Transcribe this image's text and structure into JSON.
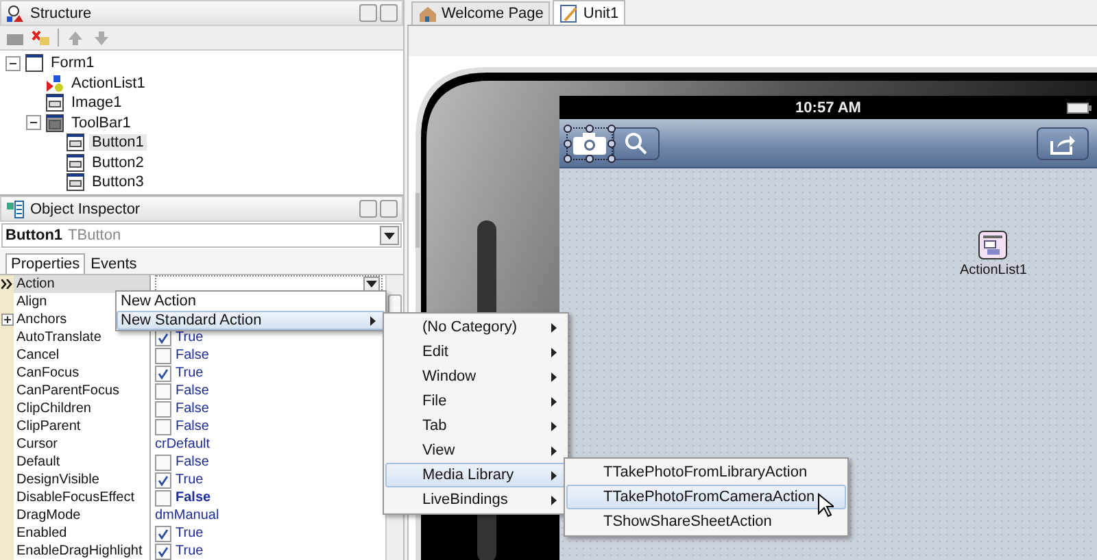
{
  "structure": {
    "title": "Structure",
    "tree": [
      {
        "label": "Form1",
        "kind": "form",
        "selected": false,
        "expanded": true,
        "children": [
          {
            "label": "ActionList1",
            "kind": "actionlist",
            "selected": false
          },
          {
            "label": "Image1",
            "kind": "control",
            "selected": false
          },
          {
            "label": "ToolBar1",
            "kind": "toolbar",
            "selected": false,
            "expanded": true,
            "children": [
              {
                "label": "Button1",
                "kind": "control",
                "selected": true
              },
              {
                "label": "Button2",
                "kind": "control",
                "selected": false
              },
              {
                "label": "Button3",
                "kind": "control",
                "selected": false
              }
            ]
          }
        ]
      }
    ]
  },
  "inspector": {
    "title": "Object Inspector",
    "object_name": "Button1",
    "object_type": "TButton",
    "tabs": [
      {
        "label": "Properties",
        "selected": true
      },
      {
        "label": "Events",
        "selected": false
      }
    ],
    "rows": [
      {
        "name": "Action",
        "kind": "dropdown",
        "selected": true
      },
      {
        "name": "Align",
        "kind": "covered",
        "selected": false
      },
      {
        "name": "Anchors",
        "kind": "set",
        "selected": false
      },
      {
        "name": "AutoTranslate",
        "kind": "bool",
        "checked": true,
        "value": "True",
        "selected": false,
        "modified": false
      },
      {
        "name": "Cancel",
        "kind": "bool",
        "checked": false,
        "value": "False",
        "selected": false,
        "modified": false
      },
      {
        "name": "CanFocus",
        "kind": "bool",
        "checked": true,
        "value": "True",
        "selected": false,
        "modified": false
      },
      {
        "name": "CanParentFocus",
        "kind": "bool",
        "checked": false,
        "value": "False",
        "selected": false,
        "modified": false
      },
      {
        "name": "ClipChildren",
        "kind": "bool",
        "checked": false,
        "value": "False",
        "selected": false,
        "modified": false
      },
      {
        "name": "ClipParent",
        "kind": "bool",
        "checked": false,
        "value": "False",
        "selected": false,
        "modified": false
      },
      {
        "name": "Cursor",
        "kind": "enum",
        "value": "crDefault",
        "selected": false,
        "modified": false
      },
      {
        "name": "Default",
        "kind": "bool",
        "checked": false,
        "value": "False",
        "selected": false,
        "modified": false
      },
      {
        "name": "DesignVisible",
        "kind": "bool",
        "checked": true,
        "value": "True",
        "selected": false,
        "modified": false
      },
      {
        "name": "DisableFocusEffect",
        "kind": "bool",
        "checked": false,
        "value": "False",
        "selected": false,
        "modified": true
      },
      {
        "name": "DragMode",
        "kind": "enum",
        "value": "dmManual",
        "selected": false,
        "modified": false
      },
      {
        "name": "Enabled",
        "kind": "bool",
        "checked": true,
        "value": "True",
        "selected": false,
        "modified": false
      },
      {
        "name": "EnableDragHighlight",
        "kind": "bool",
        "checked": true,
        "value": "True",
        "selected": false,
        "modified": false
      }
    ]
  },
  "editor_tabs": [
    {
      "label": "Welcome Page",
      "kind": "home",
      "selected": false
    },
    {
      "label": "Unit1",
      "kind": "unit",
      "selected": true
    }
  ],
  "device": {
    "time": "10:57 AM",
    "component_label": "ActionList1"
  },
  "dropdown": [
    {
      "label": "New Action",
      "submenu": false,
      "selected": false
    },
    {
      "label": "New Standard Action",
      "submenu": true,
      "selected": true
    }
  ],
  "category_menu": [
    {
      "label": "(No Category)",
      "selected": false
    },
    {
      "label": "Edit",
      "selected": false
    },
    {
      "label": "Window",
      "selected": false
    },
    {
      "label": "File",
      "selected": false
    },
    {
      "label": "Tab",
      "selected": false
    },
    {
      "label": "View",
      "selected": false
    },
    {
      "label": "Media Library",
      "selected": true
    },
    {
      "label": "LiveBindings",
      "selected": false
    }
  ],
  "action_menu": [
    {
      "label": "TTakePhotoFromLibraryAction",
      "selected": false
    },
    {
      "label": "TTakePhotoFromCameraAction",
      "selected": true
    },
    {
      "label": "TShowShareSheetAction",
      "selected": false
    }
  ]
}
